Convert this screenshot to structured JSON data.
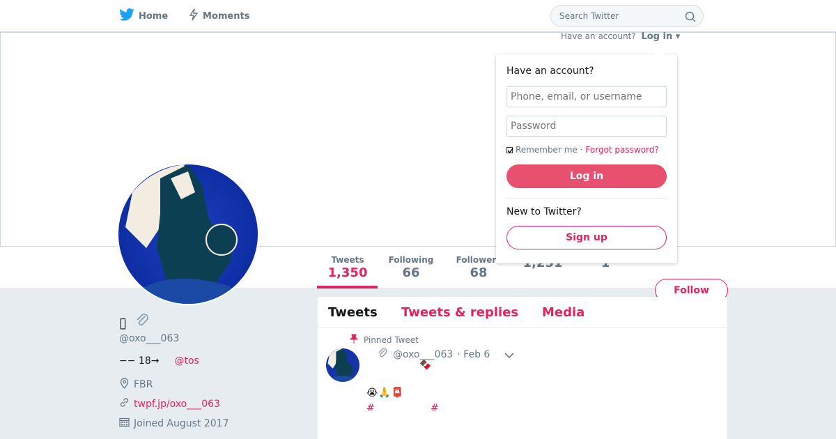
{
  "nav": {
    "home": "Home",
    "moments": "Moments",
    "search_placeholder": "Search Twitter"
  },
  "stats": [
    {
      "label": "Tweets",
      "value": "1,350"
    },
    {
      "label": "Following",
      "value": "66"
    },
    {
      "label": "Followers",
      "value": "68"
    },
    {
      "label": "",
      "value": "1,251"
    },
    {
      "label": "",
      "value": "1"
    }
  ],
  "follow_label": "Follow",
  "profile": {
    "name_glyph": "▯",
    "handle": "@oxo___063",
    "bio_text": "−− 18→",
    "bio_link": "@tos",
    "location": "FBR",
    "url": "twpf.jp/oxo___063",
    "joined": "Joined August 2017"
  },
  "timeline": {
    "tabs": [
      "Tweets",
      "Tweets & replies",
      "Media"
    ],
    "pinned_label": "Pinned Tweet",
    "tweet": {
      "handle": "@oxo___063",
      "date": "· Feb 6",
      "line1": "🍫",
      "line2": "😭🙏📮",
      "hash1": "#",
      "hash2": "#"
    }
  },
  "login": {
    "have_account_prefix": "Have an account?",
    "login_link": "Log in",
    "title": "Have an account?",
    "username_placeholder": "Phone, email, or username",
    "password_placeholder": "Password",
    "remember": "Remember me ·",
    "forgot": "Forgot password?",
    "login_button": "Log in",
    "new_to": "New to Twitter?",
    "signup_button": "Sign up"
  },
  "colors": {
    "accent": "#e0245e",
    "login_button": "#e8506f",
    "twitter_blue": "#1da1f2",
    "background": "#e6ecf0"
  }
}
